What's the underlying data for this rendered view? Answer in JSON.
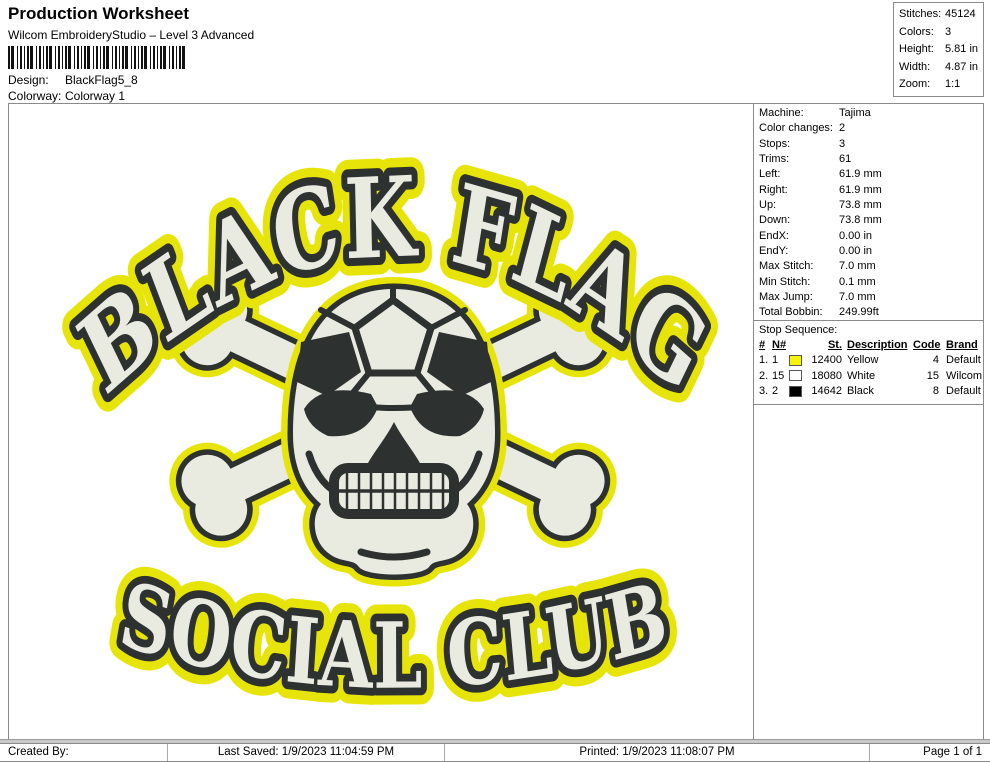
{
  "header": {
    "title": "Production Worksheet",
    "subtitle": "Wilcom EmbroideryStudio – Level 3 Advanced",
    "design_label": "Design:",
    "design_value": "BlackFlag5_8",
    "colorway_label": "Colorway:",
    "colorway_value": "Colorway 1"
  },
  "stats": {
    "rows": [
      {
        "label": "Stitches:",
        "value": "45124"
      },
      {
        "label": "Colors:",
        "value": "3"
      },
      {
        "label": "Height:",
        "value": "5.81 in"
      },
      {
        "label": "Width:",
        "value": "4.87 in"
      },
      {
        "label": "Zoom:",
        "value": "1:1"
      }
    ]
  },
  "machine": {
    "rows": [
      {
        "label": "Machine:",
        "value": "Tajima"
      },
      {
        "label": "Color changes:",
        "value": "2"
      },
      {
        "label": "Stops:",
        "value": "3"
      },
      {
        "label": "Trims:",
        "value": "61"
      },
      {
        "label": "Left:",
        "value": "61.9 mm"
      },
      {
        "label": "Right:",
        "value": "61.9 mm"
      },
      {
        "label": "Up:",
        "value": "73.8 mm"
      },
      {
        "label": "Down:",
        "value": "73.8 mm"
      },
      {
        "label": "EndX:",
        "value": "0.00 in"
      },
      {
        "label": "EndY:",
        "value": "0.00 in"
      },
      {
        "label": "Max Stitch:",
        "value": "7.0 mm"
      },
      {
        "label": "Min Stitch:",
        "value": "0.1 mm"
      },
      {
        "label": "Max Jump:",
        "value": "7.0 mm"
      },
      {
        "label": "Total Bobbin:",
        "value": "249.99ft"
      }
    ]
  },
  "stop_sequence": {
    "title": "Stop Sequence:",
    "headers": {
      "seq": "#",
      "n": "N#",
      "st": "St.",
      "description": "Description",
      "code": "Code",
      "brand": "Brand"
    },
    "rows": [
      {
        "seq": "1.",
        "n": "1",
        "swatch": "#f7f408",
        "st": "12400",
        "description": "Yellow",
        "code": "4",
        "brand": "Default"
      },
      {
        "seq": "2.",
        "n": "15",
        "swatch": "#ffffff",
        "st": "18080",
        "description": "White",
        "code": "15",
        "brand": "Wilcom"
      },
      {
        "seq": "3.",
        "n": "2",
        "swatch": "#000000",
        "st": "14642",
        "description": "Black",
        "code": "8",
        "brand": "Default"
      }
    ]
  },
  "artwork": {
    "line1": "BLACK FLAG",
    "line2": "SOCIAL CLUB",
    "colors": {
      "yellow": "#e7e40a",
      "white": "#e9ebe1",
      "dark": "#2d312f"
    }
  },
  "footer": {
    "created_by": "Created By:",
    "last_saved": "Last Saved: 1/9/2023 11:04:59 PM",
    "printed": "Printed: 1/9/2023 11:08:07 PM",
    "page": "Page 1 of 1"
  }
}
